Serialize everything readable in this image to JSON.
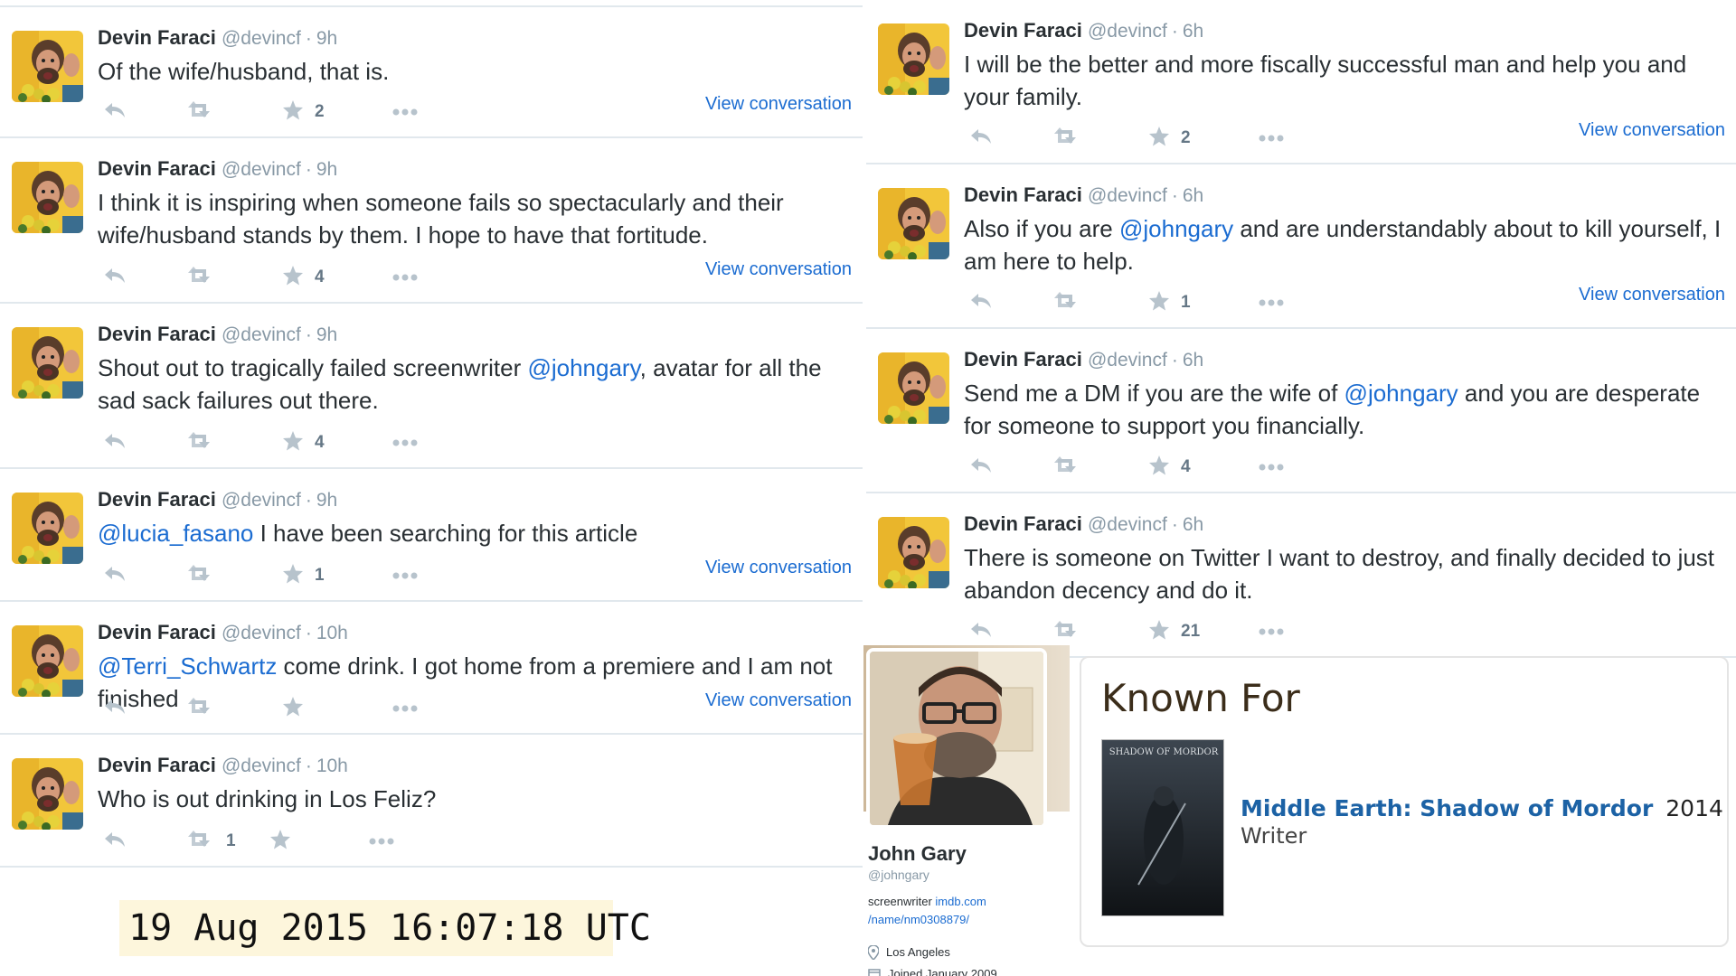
{
  "tweets_left": [
    {
      "name": "Devin Faraci",
      "handle": "@devincf",
      "time": "9h",
      "text_parts": [
        "Of the wife/husband, that is."
      ],
      "fav_count": "2",
      "rt_count": "",
      "view_conversation": "View conversation"
    },
    {
      "name": "Devin Faraci",
      "handle": "@devincf",
      "time": "9h",
      "text_parts": [
        "I think it is inspiring when someone fails so spectacularly and their wife/husband stands by them. I hope to have that fortitude."
      ],
      "fav_count": "4",
      "rt_count": "",
      "view_conversation": "View conversation"
    },
    {
      "name": "Devin Faraci",
      "handle": "@devincf",
      "time": "9h",
      "text_before": "Shout out to tragically failed screenwriter ",
      "mention": "@johngary",
      "text_after": ", avatar for all the sad sack failures out there.",
      "fav_count": "4",
      "rt_count": ""
    },
    {
      "name": "Devin Faraci",
      "handle": "@devincf",
      "time": "9h",
      "text_before": "",
      "mention": "@lucia_fasano",
      "text_after": " I have been searching for this article",
      "fav_count": "1",
      "rt_count": "",
      "view_conversation": "View conversation"
    },
    {
      "name": "Devin Faraci",
      "handle": "@devincf",
      "time": "10h",
      "text_before": "",
      "mention": "@Terri_Schwartz",
      "text_after": " come drink. I got home from a premiere and I am not finished",
      "fav_count": "",
      "rt_count": "",
      "view_conversation": "View conversation"
    },
    {
      "name": "Devin Faraci",
      "handle": "@devincf",
      "time": "10h",
      "text_parts": [
        "Who is out drinking in Los Feliz?"
      ],
      "fav_count": "",
      "rt_count": "1"
    }
  ],
  "tweets_right": [
    {
      "name": "Devin Faraci",
      "handle": "@devincf",
      "time": "6h",
      "text_parts": [
        "I will be the better and more fiscally successful man and help you and your family."
      ],
      "fav_count": "2",
      "view_conversation": "View conversation"
    },
    {
      "name": "Devin Faraci",
      "handle": "@devincf",
      "time": "6h",
      "text_before": "Also if you are ",
      "mention": "@johngary",
      "text_after": " and are understandably about to kill yourself, I am here to help.",
      "fav_count": "1",
      "view_conversation": "View conversation"
    },
    {
      "name": "Devin Faraci",
      "handle": "@devincf",
      "time": "6h",
      "text_before": "Send me a DM if you are the wife of ",
      "mention": "@johngary",
      "text_after": " and you are desperate for someone to support you financially.",
      "fav_count": "4"
    },
    {
      "name": "Devin Faraci",
      "handle": "@devincf",
      "time": "6h",
      "text_parts": [
        "There is someone on Twitter I want to destroy, and finally decided to just abandon decency and do it."
      ],
      "fav_count": "21"
    }
  ],
  "separator": "·",
  "timestamp": "19 Aug 2015 16:07:18 UTC",
  "profile": {
    "name": "John Gary",
    "handle": "@johngary",
    "bio_text": "screenwriter ",
    "bio_link_1": "imdb.com",
    "bio_link_2": "/name/nm0308879/",
    "location": "Los Angeles",
    "joined": "Joined January 2009"
  },
  "known_for": {
    "title": "Known For",
    "poster_text": "SHADOW OF MORDOR",
    "movie": "Middle Earth: Shadow of Mordor",
    "year": "2014",
    "role": "Writer"
  },
  "colors": {
    "mention": "#1b6cd1",
    "meta": "#8899a6",
    "icon": "#b7c3cc",
    "timestamp_bg": "#fdf6dc",
    "imdb_link": "#1c62a5"
  },
  "icons": [
    "reply-icon",
    "retweet-icon",
    "favorite-star-icon",
    "more-icon",
    "location-pin-icon",
    "calendar-icon"
  ]
}
